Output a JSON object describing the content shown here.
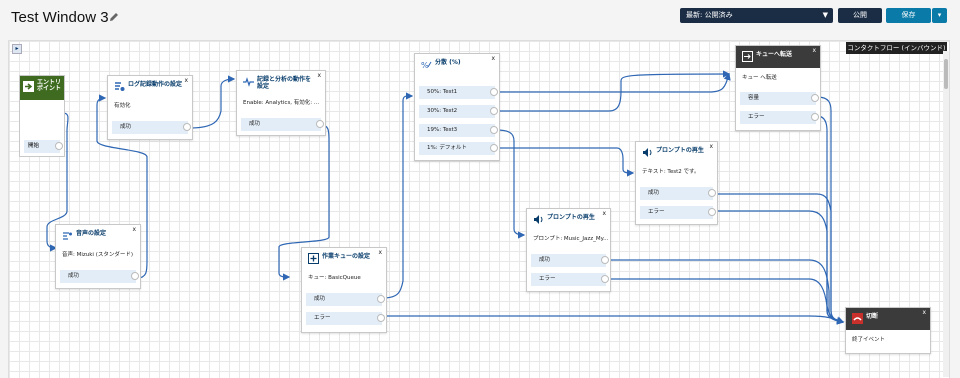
{
  "header": {
    "title": "Test Window 3",
    "version_select": "最新: 公開済み",
    "publish_label": "公開",
    "save_label": "保存"
  },
  "canvas": {
    "flow_type_label": "コンタクトフロー (インバウンド)",
    "collapse_icon": "▸",
    "close_glyph": "x"
  },
  "nodes": {
    "entry": {
      "title": "エントリポイント",
      "port": "開始"
    },
    "log": {
      "title": "ログ記録動作の設定",
      "desc": "有効化",
      "ports": [
        "成功"
      ]
    },
    "analytics": {
      "title": "記録と分析の動作を設定",
      "desc": "Enable: Analytics, 有効化: ...",
      "ports": [
        "成功"
      ]
    },
    "voice": {
      "title": "音声の設定",
      "desc": "音声: Mizuki (スタンダード)",
      "ports": [
        "成功"
      ]
    },
    "queue": {
      "title": "作業キューの設定",
      "desc": "キュー: BasicQueue",
      "ports": [
        "成功",
        "エラー"
      ]
    },
    "split": {
      "title": "分散 (%)",
      "ports": [
        "50%: Test1",
        "30%: Test2",
        "19%: Test3",
        "1%: デフォルト"
      ]
    },
    "prompt1": {
      "title": "プロンプトの再生",
      "desc": "プロンプト: Music_Jazz_My...",
      "ports": [
        "成功",
        "エラー"
      ]
    },
    "prompt2": {
      "title": "プロンプトの再生",
      "desc": "テキスト: Test2 です。",
      "ports": [
        "成功",
        "エラー"
      ]
    },
    "transfer": {
      "title": "キューへ転送",
      "desc": "キュー へ転送",
      "ports": [
        "容量",
        "エラー"
      ]
    },
    "disconnect": {
      "title": "切断",
      "desc": "終了イベント"
    }
  },
  "colors": {
    "wire": "#2f67b4",
    "header_dark": "#1b2d45",
    "save": "#0a7ba8",
    "entry": "#3e6b20",
    "port_bg": "#e3edf7"
  }
}
